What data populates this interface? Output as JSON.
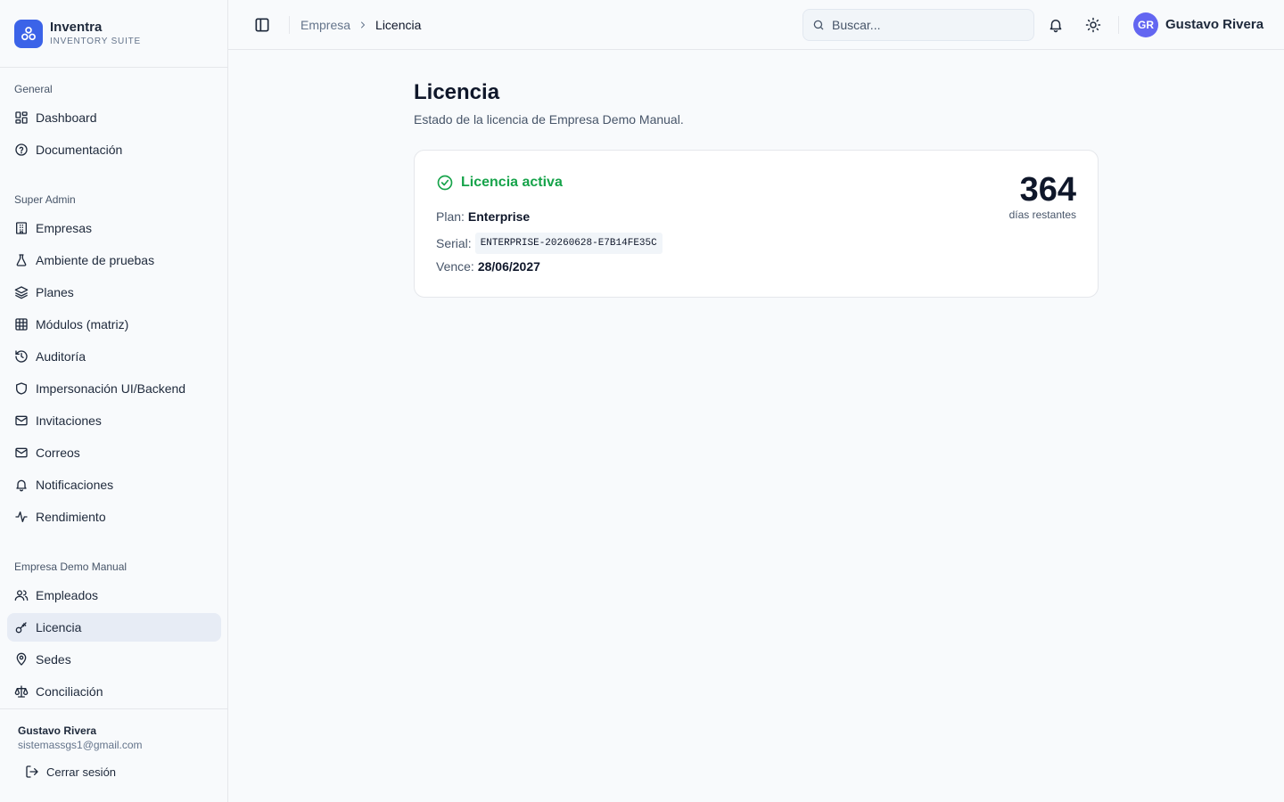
{
  "brand": {
    "name": "Inventra",
    "subtitle": "INVENTORY SUITE"
  },
  "sidebar": {
    "groups": [
      {
        "title": "General",
        "items": [
          {
            "label": "Dashboard",
            "icon": "grid-icon"
          },
          {
            "label": "Documentación",
            "icon": "help-circle-icon"
          }
        ]
      },
      {
        "title": "Super Admin",
        "items": [
          {
            "label": "Empresas",
            "icon": "building-icon"
          },
          {
            "label": "Ambiente de pruebas",
            "icon": "flask-icon"
          },
          {
            "label": "Planes",
            "icon": "layers-icon"
          },
          {
            "label": "Módulos (matriz)",
            "icon": "table-icon"
          },
          {
            "label": "Auditoría",
            "icon": "history-icon"
          },
          {
            "label": "Impersonación UI/Backend",
            "icon": "shield-icon"
          },
          {
            "label": "Invitaciones",
            "icon": "mail-icon"
          },
          {
            "label": "Correos",
            "icon": "mail-icon"
          },
          {
            "label": "Notificaciones",
            "icon": "bell-icon"
          },
          {
            "label": "Rendimiento",
            "icon": "activity-icon"
          }
        ]
      },
      {
        "title": "Empresa Demo Manual",
        "items": [
          {
            "label": "Empleados",
            "icon": "users-icon"
          },
          {
            "label": "Licencia",
            "icon": "key-icon",
            "active": true
          },
          {
            "label": "Sedes",
            "icon": "map-pin-icon"
          },
          {
            "label": "Conciliación",
            "icon": "scale-icon"
          }
        ]
      }
    ],
    "footer": {
      "user_name": "Gustavo Rivera",
      "user_email": "sistemassgs1@gmail.com",
      "logout_label": "Cerrar sesión"
    }
  },
  "header": {
    "breadcrumb_parent": "Empresa",
    "breadcrumb_current": "Licencia",
    "search_placeholder": "Buscar...",
    "avatar_initials": "GR",
    "user_name": "Gustavo Rivera"
  },
  "page": {
    "title": "Licencia",
    "subtitle": "Estado de la licencia de Empresa Demo Manual."
  },
  "license": {
    "status": "Licencia activa",
    "plan_label": "Plan:",
    "plan_value": "Enterprise",
    "serial_label": "Serial:",
    "serial_value": "ENTERPRISE-20260628-E7B14FE35C",
    "expires_label": "Vence:",
    "expires_value": "28/06/2027",
    "days_remaining": "364",
    "days_label": "días restantes"
  },
  "colors": {
    "brand": "#3b63e8",
    "active_status": "#16a34a",
    "avatar": "#6366f1",
    "active_nav_bg": "#e7ecf5"
  }
}
